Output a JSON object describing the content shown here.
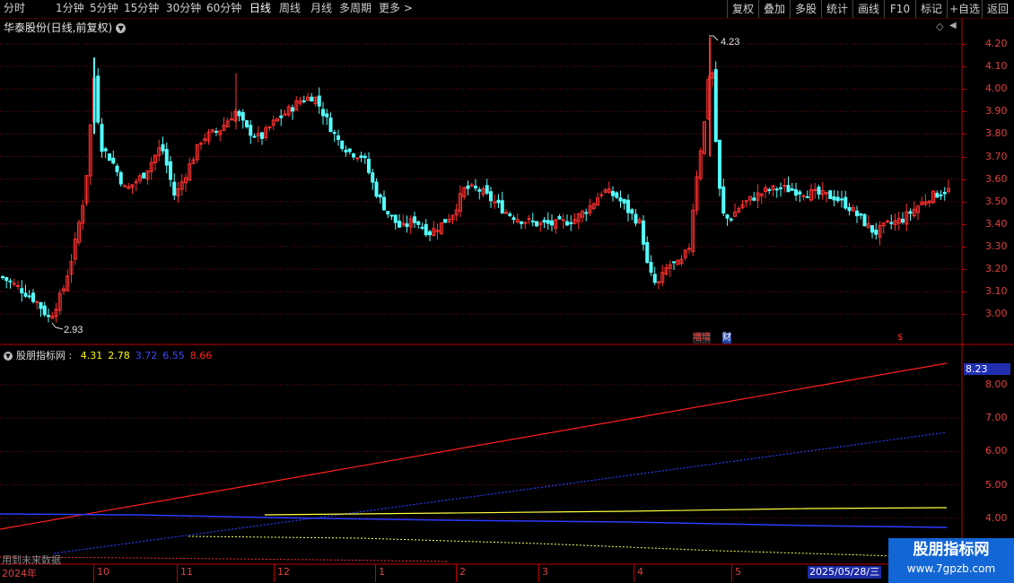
{
  "toolbar": {
    "periods": [
      "分时",
      "1分钟",
      "5分钟",
      "15分钟",
      "30分钟",
      "60分钟",
      "日线",
      "周线",
      "月线",
      "多周期",
      "更多"
    ],
    "active_period": "日线",
    "right_buttons": [
      "复权",
      "叠加",
      "多股",
      "统计",
      "画线",
      "F10",
      "标记",
      "+自选",
      "返回"
    ]
  },
  "chart_title": "华泰股份(日线,前复权)",
  "price_axis": {
    "ticks": [
      "4.20",
      "4.10",
      "4.00",
      "3.90",
      "3.80",
      "3.70",
      "3.60",
      "3.50",
      "3.40",
      "3.30",
      "3.20",
      "3.10",
      "3.00"
    ],
    "high_marker": "4.23",
    "low_marker": "2.93"
  },
  "event_badges": {
    "increase": "増增",
    "finance": "财",
    "dividend": "$"
  },
  "indicator": {
    "name": "股朋指标网",
    "values": [
      {
        "text": "4.31",
        "color": "#ffff00"
      },
      {
        "text": "2.78",
        "color": "#ffff00"
      },
      {
        "text": "3.72",
        "color": "#3a4bff"
      },
      {
        "text": "6.55",
        "color": "#3a4bff"
      },
      {
        "text": "8.66",
        "color": "#ff2020"
      }
    ],
    "axis_ticks": [
      "8.00",
      "7.00",
      "6.00",
      "5.00",
      "4.00"
    ],
    "current_value": "8.23"
  },
  "hint_text": "用到未来数据",
  "time_axis": {
    "labels": [
      "2024年",
      "10",
      "11",
      "12",
      "1",
      "2",
      "3",
      "4",
      "5"
    ],
    "cursor_date": "2025/05/28/三"
  },
  "watermark": {
    "title": "股朋指标网",
    "url": "www.7gpzb.com"
  },
  "colors": {
    "up": "#ff3030",
    "down": "#54ffff",
    "grid": "#8b0000",
    "axis": "#c00000"
  }
}
